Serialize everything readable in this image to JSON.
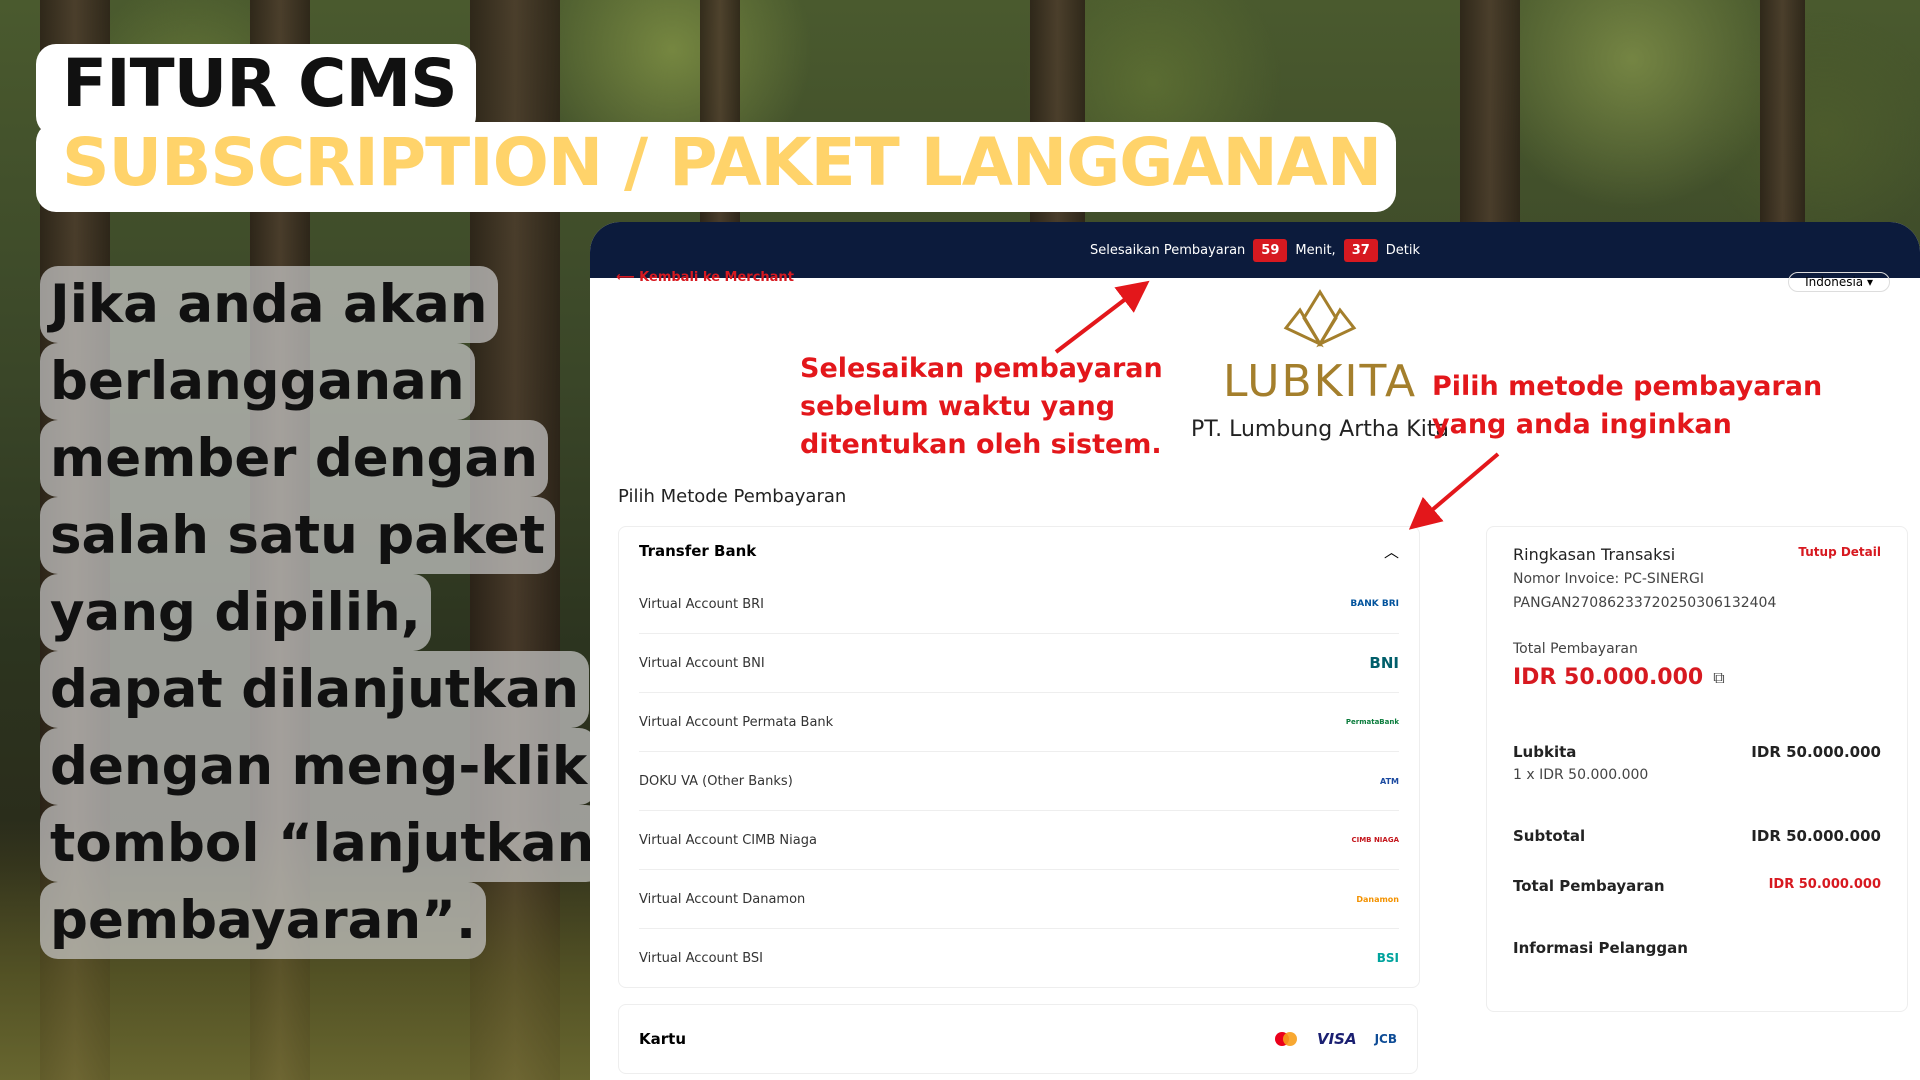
{
  "header": {
    "title_line1": "FITUR CMS",
    "title_line2": "SUBSCRIPTION / PAKET LANGGANAN"
  },
  "description": [
    "Jika anda akan",
    "berlangganan",
    "member dengan",
    "salah satu paket",
    "yang dipilih,",
    "dapat dilanjutkan",
    "dengan meng-klik",
    "tombol “lanjutkan",
    "pembayaran”."
  ],
  "checkout": {
    "timer": {
      "prefix": "Selesaikan Pembayaran",
      "minutes": "59",
      "minutes_label": "Menit,",
      "seconds": "37",
      "seconds_label": "Detik"
    },
    "back_link": "Kembali ke Merchant",
    "language": "Indonesia",
    "logo_text": "LUBKITA",
    "company": "PT. Lumbung Artha Kita",
    "section_title": "Pilih Metode Pembayaran",
    "transfer_bank": {
      "label": "Transfer Bank",
      "methods": [
        {
          "name": "Virtual Account BRI",
          "logo": "BANK BRI"
        },
        {
          "name": "Virtual Account BNI",
          "logo": "BNI"
        },
        {
          "name": "Virtual Account Permata Bank",
          "logo": "PermataBank"
        },
        {
          "name": "DOKU VA (Other Banks)",
          "logo": "ATM"
        },
        {
          "name": "Virtual Account CIMB Niaga",
          "logo": "CIMB NIAGA"
        },
        {
          "name": "Virtual Account Danamon",
          "logo": "Danamon"
        },
        {
          "name": "Virtual Account BSI",
          "logo": "BSI"
        }
      ]
    },
    "kartu": {
      "label": "Kartu",
      "cards": [
        "VISA",
        "JCB"
      ]
    },
    "summary": {
      "title": "Ringkasan Transaksi",
      "close_detail": "Tutup Detail",
      "invoice_label": "Nomor Invoice: PC-SINERGI",
      "invoice_number": "PANGAN270862337202503061324​04",
      "total_label": "Total Pembayaran",
      "total_value": "IDR 50.000.000",
      "item_name": "Lubkita",
      "item_price": "IDR 50.000.000",
      "item_qty": "1 x IDR 50.000.000",
      "subtotal_label": "Subtotal",
      "subtotal_value": "IDR 50.000.000",
      "grand_total_label": "Total Pembayaran",
      "grand_total_value": "IDR 50.000.000",
      "customer_info": "Informasi Pelanggan"
    }
  },
  "annotations": {
    "timer_note": [
      "Selesaikan pembayaran",
      "sebelum waktu yang",
      "ditentukan oleh sistem."
    ],
    "method_note": [
      "Pilih metode pembayaran",
      "yang anda inginkan"
    ]
  },
  "colors": {
    "accent_red": "#d71920",
    "navy": "#0c1b3c",
    "title_yellow": "#ffd36a",
    "gold": "#a47f2c"
  }
}
